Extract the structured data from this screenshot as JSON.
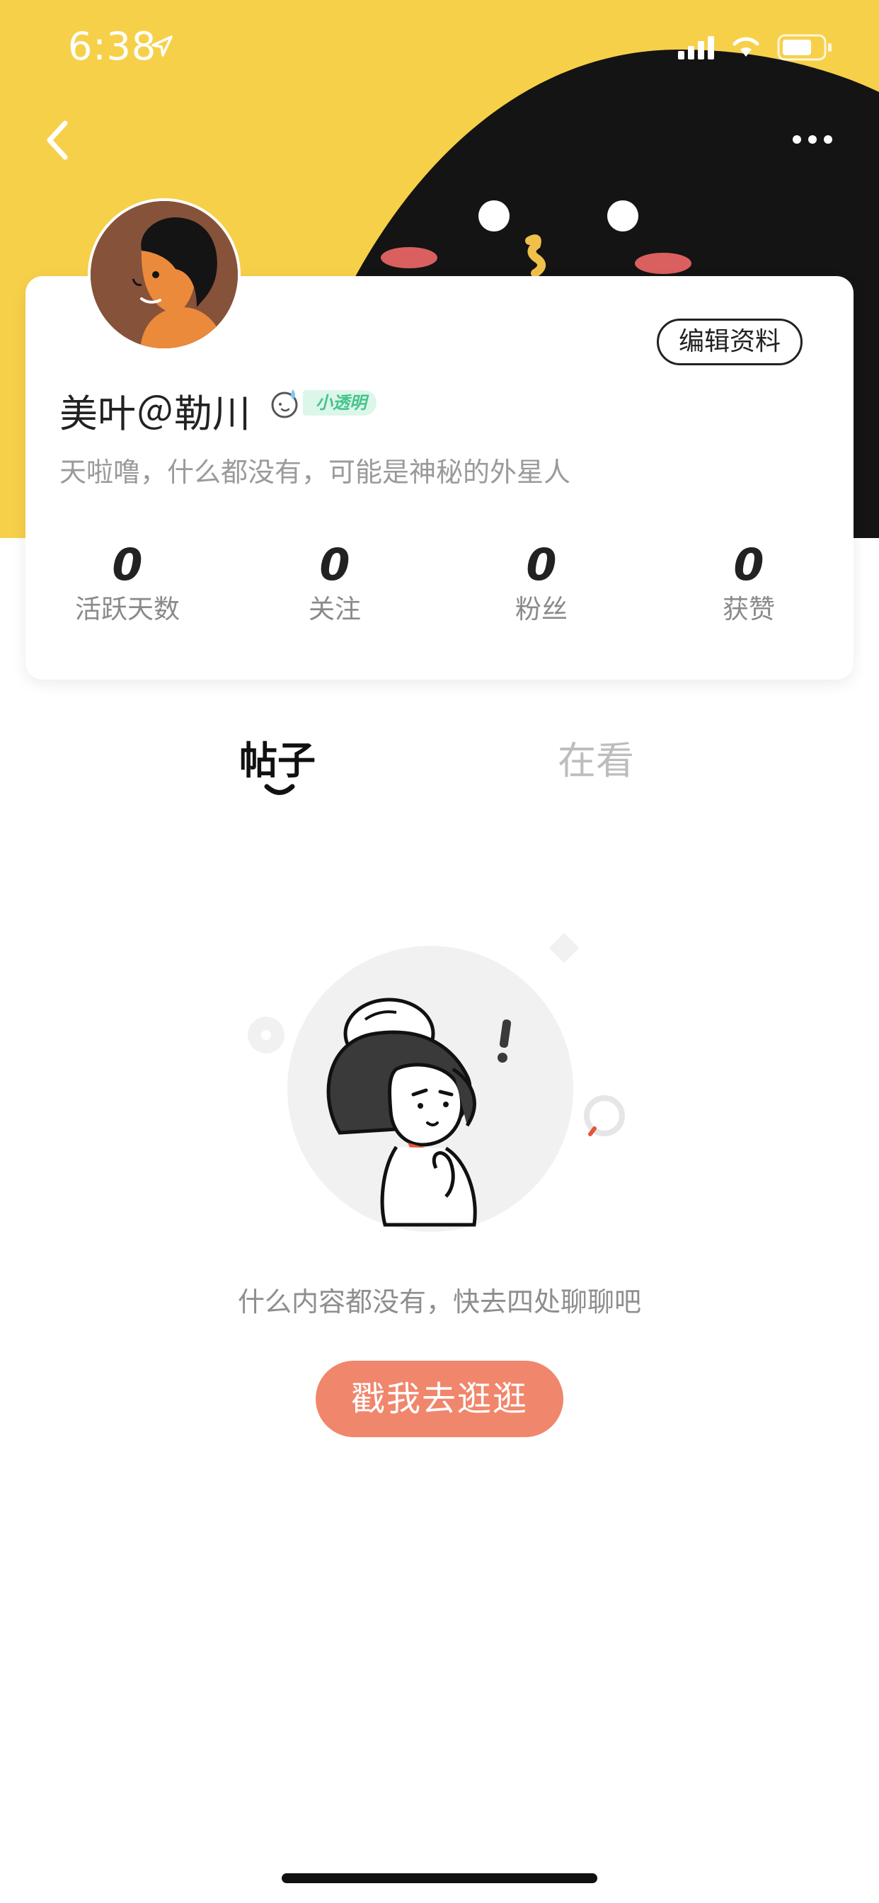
{
  "status_bar": {
    "time": "6:38"
  },
  "profile": {
    "name": "美叶＠勒川",
    "level_badge": "小透明",
    "bio": "天啦噜，什么都没有，可能是神秘的外星人",
    "edit_button": "编辑资料",
    "stats": [
      {
        "value": "0",
        "label": "活跃天数"
      },
      {
        "value": "0",
        "label": "关注"
      },
      {
        "value": "0",
        "label": "粉丝"
      },
      {
        "value": "0",
        "label": "获赞"
      }
    ]
  },
  "tabs": [
    {
      "label": "帖子",
      "active": true
    },
    {
      "label": "在看",
      "active": false
    }
  ],
  "empty_state": {
    "message": "什么内容都没有，快去四处聊聊吧",
    "button": "戳我去逛逛"
  },
  "colors": {
    "header_yellow": "#f7d04a",
    "accent_button": "#f0866b",
    "badge_green": "#46c48c"
  }
}
